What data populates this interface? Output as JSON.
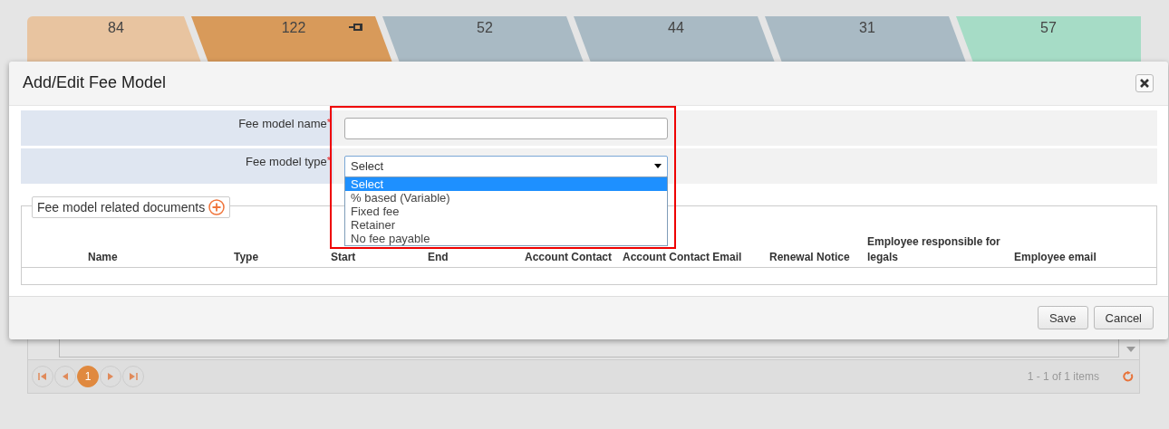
{
  "tabs": [
    {
      "count": "84",
      "color": "#e8c4a0",
      "pinned": false
    },
    {
      "count": "122",
      "color": "#d89a5a",
      "pinned": true
    },
    {
      "count": "52",
      "color": "#a9bac4",
      "pinned": false
    },
    {
      "count": "44",
      "color": "#a9bac4",
      "pinned": false
    },
    {
      "count": "31",
      "color": "#a9bac4",
      "pinned": false
    },
    {
      "count": "57",
      "color": "#a6dcc6",
      "pinned": false
    }
  ],
  "grid": {
    "pager": {
      "pages": [
        {
          "label": "1",
          "selected": true
        }
      ],
      "summary": "1 - 1 of 1 items"
    }
  },
  "dialog": {
    "title": "Add/Edit Fee Model",
    "fields": [
      {
        "kind": "text",
        "label": "Fee model name",
        "required_mark": "*"
      },
      {
        "kind": "select",
        "label": "Fee model type",
        "required_mark": "*",
        "value": "Select",
        "expanded": true,
        "options": [
          {
            "label": "Select",
            "selected": true
          },
          {
            "label": "% based (Variable)",
            "selected": false
          },
          {
            "label": "Fixed fee",
            "selected": false
          },
          {
            "label": "Retainer",
            "selected": false
          },
          {
            "label": "No fee payable",
            "selected": false
          }
        ]
      }
    ],
    "documents": {
      "legend": "Fee model related documents",
      "columns": [
        "Name",
        "Type",
        "Start",
        "End",
        "Account Contact",
        "Account Contact Email",
        "Renewal Notice",
        "Employee responsible for legals",
        "Employee email"
      ]
    },
    "buttons": [
      "Save",
      "Cancel"
    ]
  },
  "highlight_box": true
}
